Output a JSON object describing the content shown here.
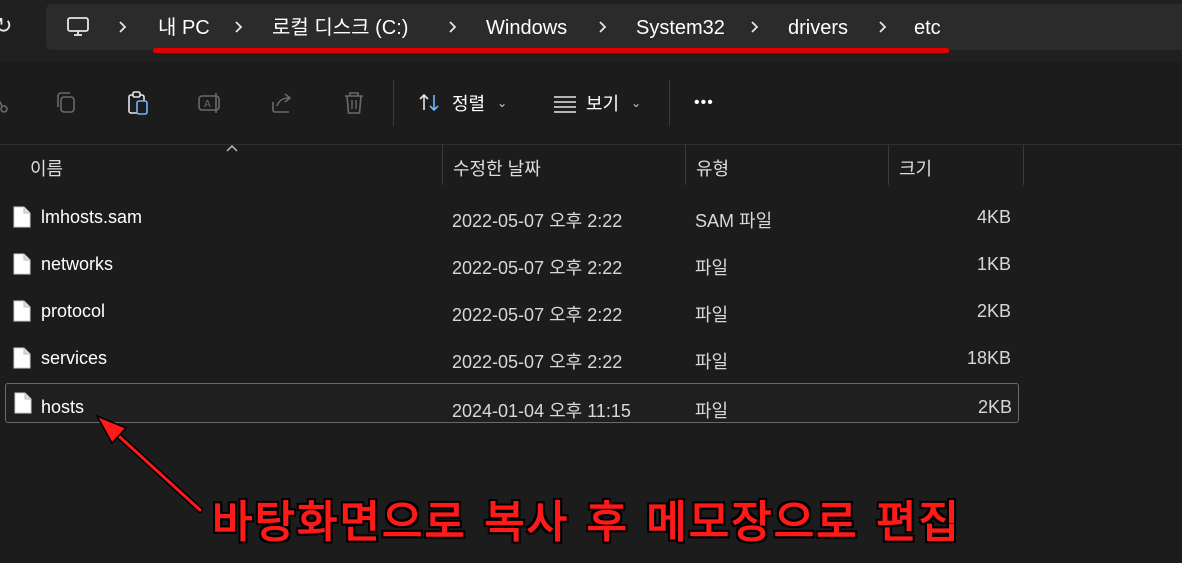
{
  "breadcrumb": [
    "내 PC",
    "로컬 디스크 (C:)",
    "Windows",
    "System32",
    "drivers",
    "etc"
  ],
  "toolbar": {
    "sort_label": "정렬",
    "view_label": "보기",
    "more_label": "•••"
  },
  "columns": {
    "name": "이름",
    "date": "수정한 날짜",
    "type": "유형",
    "size": "크기"
  },
  "files": [
    {
      "name": "lmhosts.sam",
      "date": "2022-05-07 오후 2:22",
      "type": "SAM 파일",
      "size": "4KB"
    },
    {
      "name": "networks",
      "date": "2022-05-07 오후 2:22",
      "type": "파일",
      "size": "1KB"
    },
    {
      "name": "protocol",
      "date": "2022-05-07 오후 2:22",
      "type": "파일",
      "size": "2KB"
    },
    {
      "name": "services",
      "date": "2022-05-07 오후 2:22",
      "type": "파일",
      "size": "18KB"
    },
    {
      "name": "hosts",
      "date": "2024-01-04 오후 11:15",
      "type": "파일",
      "size": "2KB"
    }
  ],
  "annotation": "바탕화면으로 복사 후 메모장으로 편집",
  "colors": {
    "annotation": "#ff1a1a",
    "background": "#1c1c1c",
    "highlight_line": "#e00000"
  }
}
